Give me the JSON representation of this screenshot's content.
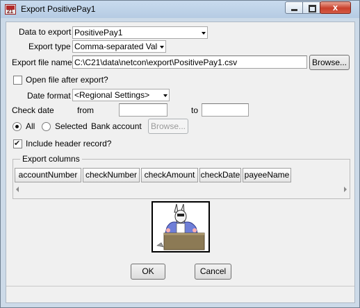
{
  "window": {
    "title": "Export PositivePay1",
    "close_glyph": "x"
  },
  "form": {
    "data_to_export": {
      "label": "Data to export",
      "value": "PositivePay1"
    },
    "export_type": {
      "label": "Export type",
      "value": "Comma-separated Valu"
    },
    "export_file_name": {
      "label": "Export file name",
      "value": "C:\\C21\\data\\netcon\\export\\PositivePay1.csv",
      "browse_label": "Browse..."
    },
    "open_file_after_export": {
      "label": "Open file after export?",
      "checked": false
    },
    "date_format": {
      "label": "Date format",
      "value": "<Regional Settings>"
    },
    "check_date": {
      "label": "Check date",
      "from_label": "from",
      "to_label": "to",
      "from_value": "",
      "to_value": ""
    },
    "bank_account": {
      "all_label": "All",
      "selected_label": "Selected",
      "label": "Bank account",
      "browse_label": "Browse...",
      "choice": "All"
    },
    "include_header_record": {
      "label": "Include header record?",
      "checked": true
    }
  },
  "export_columns": {
    "title": "Export columns",
    "columns": [
      "accountNumber",
      "checkNumber",
      "checkAmount",
      "checkDate",
      "payeeName"
    ]
  },
  "buttons": {
    "ok": "OK",
    "cancel": "Cancel"
  },
  "colors": {
    "title_bar": "#b5cbe3",
    "dialog_bg": "#f0f0f0",
    "close_button": "#c9402c"
  }
}
